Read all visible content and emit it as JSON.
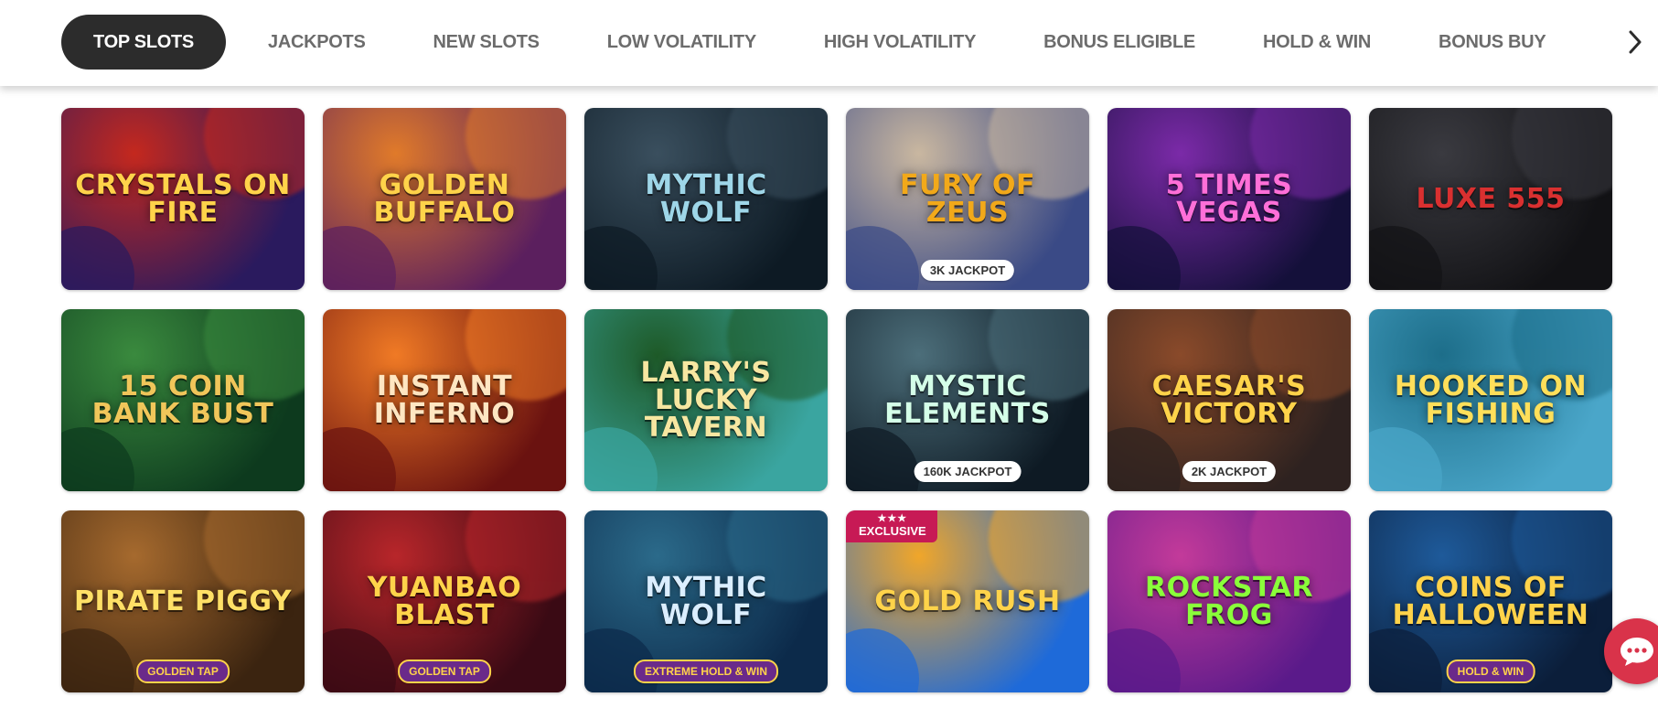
{
  "nav": {
    "tabs": [
      {
        "label": "TOP SLOTS",
        "active": true
      },
      {
        "label": "JACKPOTS"
      },
      {
        "label": "NEW SLOTS"
      },
      {
        "label": "LOW VOLATILITY"
      },
      {
        "label": "HIGH VOLATILITY"
      },
      {
        "label": "BONUS ELIGIBLE"
      },
      {
        "label": "HOLD & WIN"
      },
      {
        "label": "BONUS BUY"
      }
    ],
    "next_icon": "chevron-right-icon"
  },
  "games": [
    {
      "title": "CRYSTALS ON FIRE",
      "bg": [
        "#2a1a5e",
        "#c4281e"
      ],
      "text_color": "#ffd34a"
    },
    {
      "title": "GOLDEN BUFFALO",
      "bg": [
        "#5b1f5e",
        "#e07a2a"
      ],
      "text_color": "#ffd34a"
    },
    {
      "title": "MYTHIC WOLF",
      "bg": [
        "#0d1a24",
        "#3a4f5e"
      ],
      "text_color": "#9ed6e8"
    },
    {
      "title": "FURY OF ZEUS",
      "bg": [
        "#3a4a86",
        "#c9b7a0"
      ],
      "text_color": "#f2a91a",
      "badge": "3K JACKPOT"
    },
    {
      "title": "5 Times VEGAS",
      "bg": [
        "#14103a",
        "#7b2aa8"
      ],
      "text_color": "#ff6fd8"
    },
    {
      "title": "LUXE 555",
      "bg": [
        "#121215",
        "#3a3a40"
      ],
      "text_color": "#d93030"
    },
    {
      "title": "15 COIN BANK BUST",
      "bg": [
        "#0d3a1e",
        "#3a8a3e"
      ],
      "text_color": "#f0c65a"
    },
    {
      "title": "Instant Inferno",
      "bg": [
        "#6a1210",
        "#f07a25"
      ],
      "text_color": "#ffe6c2"
    },
    {
      "title": "LARRY'S LUCKY TAVERN",
      "bg": [
        "#3aa5a0",
        "#1e5a28"
      ],
      "text_color": "#f7e7a1"
    },
    {
      "title": "MYSTIC ELEMENTS",
      "bg": [
        "#0e1a24",
        "#4c6e7a"
      ],
      "text_color": "#d4ffe8",
      "badge": "160K JACKPOT"
    },
    {
      "title": "CAESAR'S VICTORY",
      "bg": [
        "#2e2220",
        "#8a4a2a"
      ],
      "text_color": "#ffd34a",
      "badge": "2K JACKPOT"
    },
    {
      "title": "HOOKED on FISHING",
      "bg": [
        "#4aa6c9",
        "#1d6e8a"
      ],
      "text_color": "#ffdf5a"
    },
    {
      "title": "PIRATE PIGGY",
      "bg": [
        "#3b2410",
        "#a66a2e"
      ],
      "text_color": "#ffe066",
      "tag": "GOLDEN TAP"
    },
    {
      "title": "YUANBAO BLAST",
      "bg": [
        "#3a0a14",
        "#b8262a"
      ],
      "text_color": "#ffd34a",
      "tag": "GOLDEN TAP"
    },
    {
      "title": "MYTHIC WOLF",
      "bg": [
        "#0c2a4a",
        "#2b6a8a"
      ],
      "text_color": "#dbeeff",
      "tag": "EXTREME HOLD & WIN"
    },
    {
      "title": "GOLD RUSH",
      "bg": [
        "#1e6ad9",
        "#f0a62a"
      ],
      "text_color": "#ffd34a",
      "ribbon": "EXCLUSIVE"
    },
    {
      "title": "ROCKSTAR FROG",
      "bg": [
        "#5a1a8a",
        "#c33a9a"
      ],
      "text_color": "#8aff3a"
    },
    {
      "title": "COINS of HALLOWEEN",
      "bg": [
        "#0b1e3a",
        "#1e5a9a"
      ],
      "text_color": "#ffd34a",
      "tag": "HOLD & WIN"
    }
  ],
  "chat_icon": "chat-bubble-icon"
}
